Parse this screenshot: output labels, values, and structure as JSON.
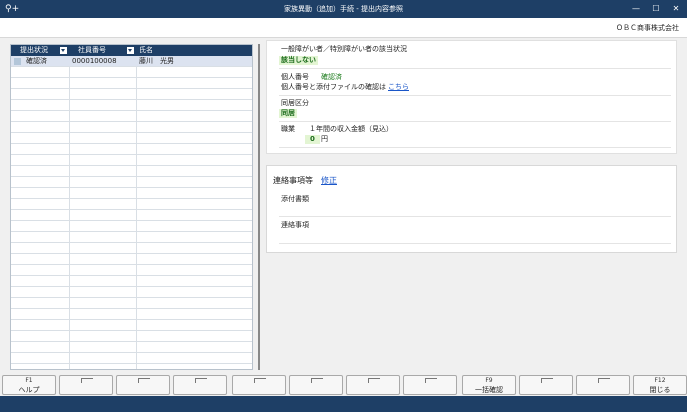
{
  "window": {
    "title": "家族異動（追加）手続 - 提出内容参照",
    "app_icon": "⚲+",
    "minimize": "—",
    "maximize": "☐",
    "close": "✕"
  },
  "header": {
    "company": "ＯＢＣ商事株式会社"
  },
  "grid": {
    "columns": [
      "提出状況",
      "社員番号",
      "氏名"
    ],
    "rows": [
      {
        "status": "確認済",
        "employee_no": "0000100008",
        "name": "藤川　光男"
      }
    ]
  },
  "detail": {
    "disability_label": "一般障がい者／特別障がい者の該当状況",
    "disability_value": "該当しない",
    "mynumber_label": "個人番号",
    "mynumber_status": "確認済",
    "mynumber_attach_label": "個人番号と添付ファイルの確認は",
    "mynumber_attach_link": "こちら",
    "cohabit_label": "同居区分",
    "cohabit_value": "同居",
    "job_label": "職業",
    "income_label": "１年間の収入金額（見込）",
    "income_value": "0",
    "income_unit": "円"
  },
  "contact": {
    "title": "連絡事項等",
    "edit_link": "修正",
    "attachment_label": "添付書類",
    "notes_label": "連絡事項"
  },
  "fkeys": [
    {
      "num": "F1",
      "label": "ヘルプ"
    },
    {
      "num": "",
      "label": ""
    },
    {
      "num": "",
      "label": ""
    },
    {
      "num": "",
      "label": ""
    },
    {
      "num": "",
      "label": ""
    },
    {
      "num": "",
      "label": ""
    },
    {
      "num": "",
      "label": ""
    },
    {
      "num": "",
      "label": ""
    },
    {
      "num": "F9",
      "label": "一括確認"
    },
    {
      "num": "",
      "label": ""
    },
    {
      "num": "",
      "label": ""
    },
    {
      "num": "F12",
      "label": "閉じる"
    }
  ]
}
